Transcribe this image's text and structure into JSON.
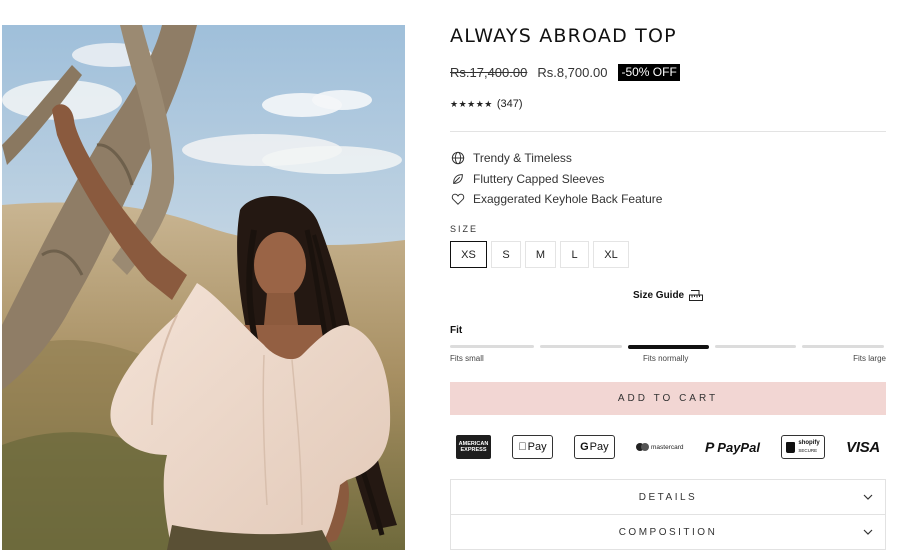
{
  "product": {
    "title": "ALWAYS ABROAD TOP",
    "price_original": "Rs.17,400.00",
    "price_sale": "Rs.8,700.00",
    "discount_badge": "-50% OFF",
    "stars": "★★★★★",
    "review_count": "(347)",
    "rating_value": 5,
    "photo": "model-in-blouse-photo"
  },
  "features": [
    {
      "icon": "globe-icon",
      "label": "Trendy & Timeless"
    },
    {
      "icon": "leaf-icon",
      "label": "Fluttery Capped Sleeves"
    },
    {
      "icon": "heart-icon",
      "label": "Exaggerated Keyhole Back Feature"
    }
  ],
  "size": {
    "label": "SIZE",
    "options": [
      "XS",
      "S",
      "M",
      "L",
      "XL"
    ],
    "selected": "XS",
    "guide_label": "Size Guide",
    "guide_icon": "ruler-icon"
  },
  "fit": {
    "label": "Fit",
    "scale_segments": 5,
    "selected_segment": 3,
    "left_label": "Fits small",
    "center_label": "Fits normally",
    "right_label": "Fits large"
  },
  "cart": {
    "button_label": "ADD TO CART"
  },
  "payments": {
    "amex_line1": "AMERICAN",
    "amex_line2": "EXPRESS",
    "applepay": "Pay",
    "googlepay": "Pay",
    "googlepay_g": "G",
    "mastercard": "mastercard",
    "paypal": "PayPal",
    "shopify_line1": "shopify",
    "shopify_line2": "SECURE",
    "visa": "VISA"
  },
  "accordions": [
    {
      "label": "DETAILS"
    },
    {
      "label": "COMPOSITION"
    }
  ],
  "colors": {
    "accent_button": "#f2d6d3",
    "badge_bg": "#000000",
    "text": "#222222"
  }
}
